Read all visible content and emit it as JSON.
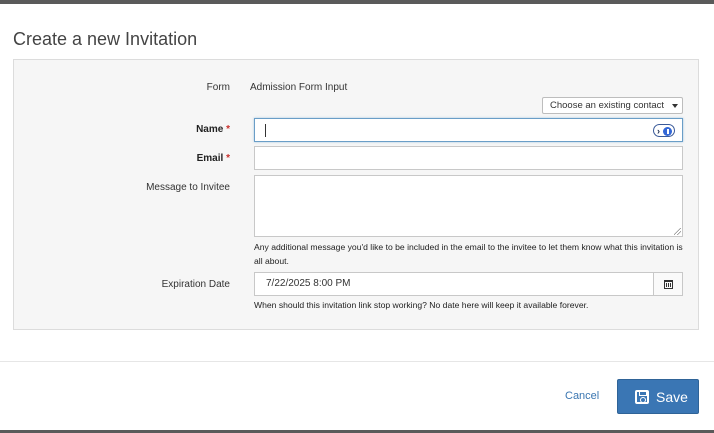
{
  "dialog": {
    "title": "Create a new Invitation"
  },
  "form": {
    "form_label": "Form",
    "form_value": "Admission Form Input",
    "choose_contact_label": "Choose an existing contact",
    "name_label": "Name",
    "name_value": "",
    "email_label": "Email",
    "email_value": "",
    "required_marker": "*",
    "message_label": "Message to Invitee",
    "message_value": "",
    "message_help": "Any additional message you'd like to be included in the email to the invitee to let them know what this invitation is all about.",
    "expiration_label": "Expiration Date",
    "expiration_value": "7/22/2025 8:00 PM",
    "expiration_help": "When should this invitation link stop working? No date here will keep it available forever."
  },
  "footer": {
    "cancel_label": "Cancel",
    "save_label": "Save"
  },
  "icons": {
    "password_manager": "password-manager-icon",
    "calendar": "calendar-icon",
    "save": "floppy-disk-icon",
    "dropdown": "caret-down-icon"
  },
  "colors": {
    "primary": "#3a76b4",
    "required": "#c9302c",
    "link": "#3a76b1"
  }
}
